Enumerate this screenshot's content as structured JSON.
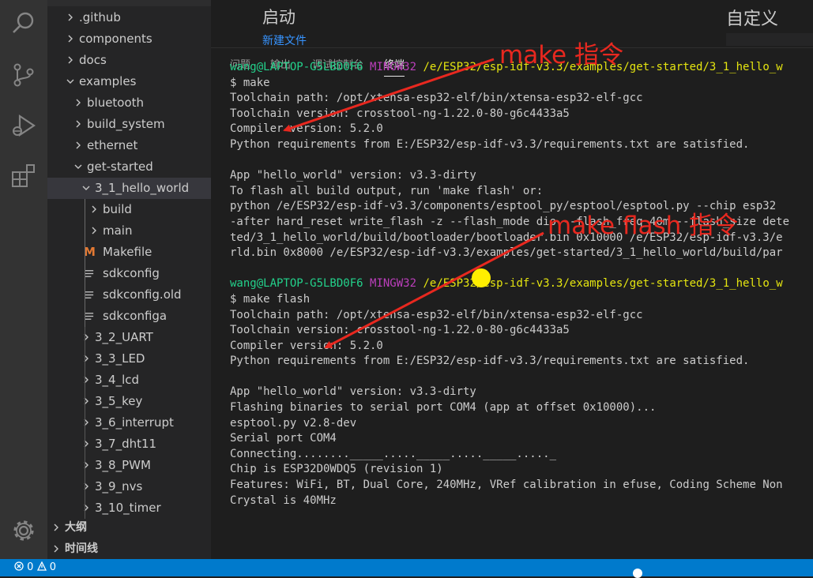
{
  "explorer": {
    "items": [
      {
        "label": ".github",
        "depth": 1,
        "type": "folder",
        "expanded": false
      },
      {
        "label": "components",
        "depth": 1,
        "type": "folder",
        "expanded": false
      },
      {
        "label": "docs",
        "depth": 1,
        "type": "folder",
        "expanded": false
      },
      {
        "label": "examples",
        "depth": 1,
        "type": "folder",
        "expanded": true
      },
      {
        "label": "bluetooth",
        "depth": 2,
        "type": "folder",
        "expanded": false
      },
      {
        "label": "build_system",
        "depth": 2,
        "type": "folder",
        "expanded": false
      },
      {
        "label": "ethernet",
        "depth": 2,
        "type": "folder",
        "expanded": false
      },
      {
        "label": "get-started",
        "depth": 2,
        "type": "folder",
        "expanded": true
      },
      {
        "label": "3_1_hello_world",
        "depth": 3,
        "type": "folder",
        "expanded": true,
        "selected": true
      },
      {
        "label": "build",
        "depth": 4,
        "type": "folder",
        "expanded": false
      },
      {
        "label": "main",
        "depth": 4,
        "type": "folder",
        "expanded": false
      },
      {
        "label": "Makefile",
        "depth": 4,
        "type": "makefile"
      },
      {
        "label": "sdkconfig",
        "depth": 4,
        "type": "file"
      },
      {
        "label": "sdkconfig.old",
        "depth": 4,
        "type": "file"
      },
      {
        "label": "sdkconfiga",
        "depth": 4,
        "type": "file"
      },
      {
        "label": "3_2_UART",
        "depth": 3,
        "type": "folder",
        "expanded": false
      },
      {
        "label": "3_3_LED",
        "depth": 3,
        "type": "folder",
        "expanded": false
      },
      {
        "label": "3_4_lcd",
        "depth": 3,
        "type": "folder",
        "expanded": false
      },
      {
        "label": "3_5_key",
        "depth": 3,
        "type": "folder",
        "expanded": false
      },
      {
        "label": "3_6_interrupt",
        "depth": 3,
        "type": "folder",
        "expanded": false
      },
      {
        "label": "3_7_dht11",
        "depth": 3,
        "type": "folder",
        "expanded": false
      },
      {
        "label": "3_8_PWM",
        "depth": 3,
        "type": "folder",
        "expanded": false
      },
      {
        "label": "3_9_nvs",
        "depth": 3,
        "type": "folder",
        "expanded": false
      },
      {
        "label": "3_10_timer",
        "depth": 3,
        "type": "folder",
        "expanded": false
      }
    ],
    "sections": [
      {
        "label": "大纲"
      },
      {
        "label": "时间线"
      }
    ]
  },
  "activity_icons": [
    "search-icon",
    "source-control-icon",
    "run-debug-icon",
    "extensions-icon",
    "settings-gear-icon"
  ],
  "welcome": {
    "title": "启动",
    "new_file": "新建文件",
    "customize": "自定义"
  },
  "panel": {
    "tabs": [
      {
        "label": "问题",
        "active": false
      },
      {
        "label": "输出",
        "active": false
      },
      {
        "label": "调试控制台",
        "active": false
      },
      {
        "label": "终端",
        "active": true
      }
    ]
  },
  "terminal": {
    "lines": [
      {
        "kind": "prompt",
        "user": "wang@LAPTOP-G5LBD0F6",
        "host": "MINGW32",
        "path": "/e/ESP32/esp-idf-v3.3/examples/get-started/3_1_hello_w"
      },
      {
        "kind": "text",
        "text": "$ make"
      },
      {
        "kind": "text",
        "text": "Toolchain path: /opt/xtensa-esp32-elf/bin/xtensa-esp32-elf-gcc"
      },
      {
        "kind": "text",
        "text": "Toolchain version: crosstool-ng-1.22.0-80-g6c4433a5"
      },
      {
        "kind": "text",
        "text": "Compiler version: 5.2.0"
      },
      {
        "kind": "text",
        "text": "Python requirements from E:/ESP32/esp-idf-v3.3/requirements.txt are satisfied."
      },
      {
        "kind": "text",
        "text": ""
      },
      {
        "kind": "text",
        "text": "App \"hello_world\" version: v3.3-dirty"
      },
      {
        "kind": "text",
        "text": "To flash all build output, run 'make flash' or:"
      },
      {
        "kind": "text",
        "text": "python /e/ESP32/esp-idf-v3.3/components/esptool_py/esptool/esptool.py --chip esp32"
      },
      {
        "kind": "text",
        "text": "-after hard_reset write_flash -z --flash_mode dio --flash_freq 40m --flash_size dete"
      },
      {
        "kind": "text",
        "text": "ted/3_1_hello_world/build/bootloader/bootloader.bin 0x10000 /e/ESP32/esp-idf-v3.3/e"
      },
      {
        "kind": "text",
        "text": "rld.bin 0x8000 /e/ESP32/esp-idf-v3.3/examples/get-started/3_1_hello_world/build/par"
      },
      {
        "kind": "text",
        "text": ""
      },
      {
        "kind": "prompt",
        "user": "wang@LAPTOP-G5LBD0F6",
        "host": "MINGW32",
        "path": "/e/ESP32/esp-idf-v3.3/examples/get-started/3_1_hello_w"
      },
      {
        "kind": "text",
        "text": "$ make flash"
      },
      {
        "kind": "text",
        "text": "Toolchain path: /opt/xtensa-esp32-elf/bin/xtensa-esp32-elf-gcc"
      },
      {
        "kind": "text",
        "text": "Toolchain version: crosstool-ng-1.22.0-80-g6c4433a5"
      },
      {
        "kind": "text",
        "text": "Compiler version: 5.2.0"
      },
      {
        "kind": "text",
        "text": "Python requirements from E:/ESP32/esp-idf-v3.3/requirements.txt are satisfied."
      },
      {
        "kind": "text",
        "text": ""
      },
      {
        "kind": "text",
        "text": "App \"hello_world\" version: v3.3-dirty"
      },
      {
        "kind": "text",
        "text": "Flashing binaries to serial port COM4 (app at offset 0x10000)..."
      },
      {
        "kind": "text",
        "text": "esptool.py v2.8-dev"
      },
      {
        "kind": "text",
        "text": "Serial port COM4"
      },
      {
        "kind": "text",
        "text": "Connecting........_____....._____....._____....._"
      },
      {
        "kind": "text",
        "text": "Chip is ESP32D0WDQ5 (revision 1)"
      },
      {
        "kind": "text",
        "text": "Features: WiFi, BT, Dual Core, 240MHz, VRef calibration in efuse, Coding Scheme Non"
      },
      {
        "kind": "text",
        "text": "Crystal is 40MHz"
      }
    ]
  },
  "annotations": {
    "make": "make 指令",
    "make_flash": "make flash 指令",
    "color": "#e8281f"
  },
  "statusbar": {
    "errors": "0",
    "warnings": "0",
    "color": "#007acc"
  }
}
